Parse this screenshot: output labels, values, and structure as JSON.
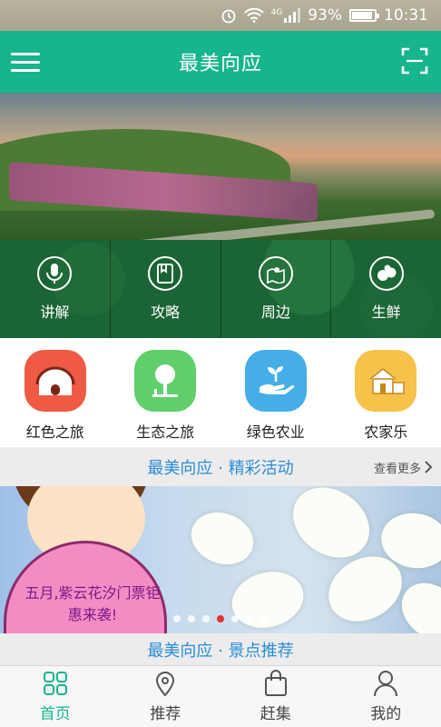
{
  "status_bar": {
    "battery": "93%",
    "time": "10:31",
    "network": "4G",
    "battery_level": 0.93
  },
  "app_bar": {
    "title": "最美向应",
    "menu_icon": "hamburger-menu-icon",
    "scan_icon": "scan-icon"
  },
  "hero": {
    "items": [
      {
        "label": "讲解",
        "icon": "microphone-icon"
      },
      {
        "label": "攻略",
        "icon": "guide-book-icon"
      },
      {
        "label": "周边",
        "icon": "map-pin-icon"
      },
      {
        "label": "生鲜",
        "icon": "fresh-produce-icon"
      }
    ]
  },
  "categories": [
    {
      "label": "红色之旅",
      "icon": "house-icon",
      "color": "#ef5a45"
    },
    {
      "label": "生态之旅",
      "icon": "tree-icon",
      "color": "#5fcf6b"
    },
    {
      "label": "绿色农业",
      "icon": "hand-sprout-icon",
      "color": "#45aee8"
    },
    {
      "label": "农家乐",
      "icon": "farmhouse-icon",
      "color": "#f6c24a"
    }
  ],
  "activities": {
    "title": "最美向应 · 精彩活动",
    "more": "查看更多"
  },
  "banner": {
    "text": "五月,紫云花汐门票钜惠来袭!",
    "dot_count": 7,
    "active_dot": 3
  },
  "attractions": {
    "title": "最美向应 · 景点推荐"
  },
  "tabs": [
    {
      "label": "首页",
      "icon": "home-grid-icon",
      "active": true
    },
    {
      "label": "推荐",
      "icon": "location-pin-icon",
      "active": false
    },
    {
      "label": "赶集",
      "icon": "shopping-bag-icon",
      "active": false
    },
    {
      "label": "我的",
      "icon": "user-icon",
      "active": false
    }
  ],
  "colors": {
    "primary": "#17b58d",
    "section_title": "#2a8dd4",
    "active_dot": "#e53333"
  }
}
